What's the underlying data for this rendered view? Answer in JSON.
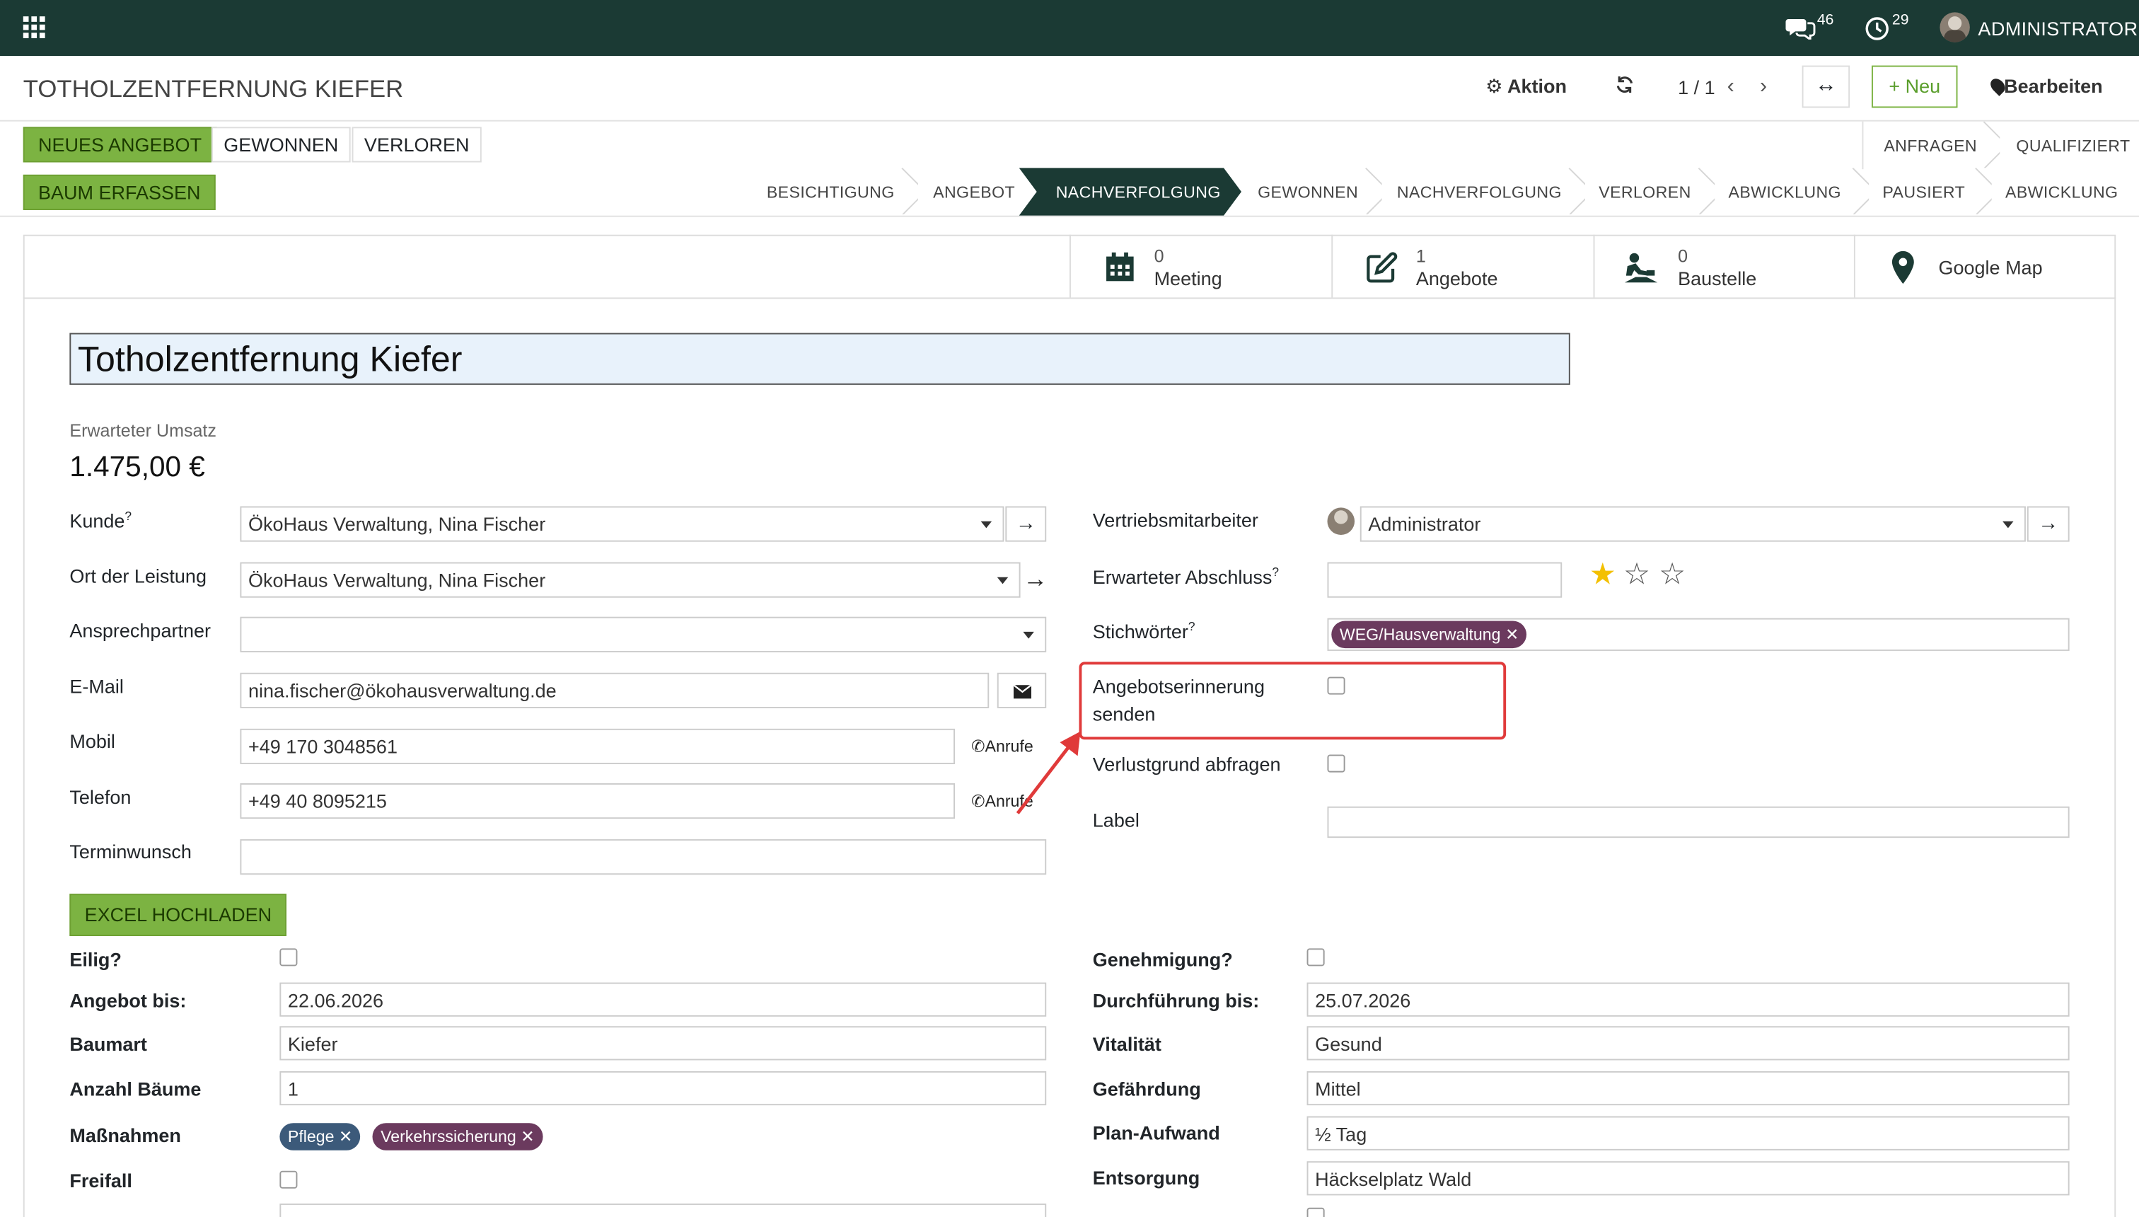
{
  "topbar": {
    "chat_count": "46",
    "activity_count": "29",
    "user": "ADMINISTRATOR"
  },
  "record": {
    "title": "TOTHOLZENTFERNUNG KIEFER",
    "action": "Aktion",
    "pager": "1 / 1",
    "new": "Neu",
    "edit": "Bearbeiten"
  },
  "buttons": {
    "new_offer": "NEUES ANGEBOT",
    "won": "GEWONNEN",
    "lost": "VERLOREN",
    "capture_tree": "BAUM ERFASSEN"
  },
  "stages_row1": [
    "ANFRAGEN",
    "QUALIFIZIERT"
  ],
  "stages": [
    "BESICHTIGUNG",
    "ANGEBOT",
    "NACHVERFOLGUNG",
    "GEWONNEN",
    "NACHVERFOLGUNG",
    "VERLOREN",
    "ABWICKLUNG",
    "PAUSIERT",
    "ABWICKLUNG"
  ],
  "smart": [
    {
      "count": "0",
      "label": "Meeting"
    },
    {
      "count": "1",
      "label": "Angebote"
    },
    {
      "count": "0",
      "label": "Baustelle"
    },
    {
      "count": "",
      "label": "Google Map"
    }
  ],
  "name": "Totholzentfernung Kiefer",
  "revenue": {
    "label": "Erwarteter Umsatz",
    "value": "1.475,00 €"
  },
  "left": {
    "kunde": {
      "label": "Kunde",
      "value": "ÖkoHaus Verwaltung, Nina Fischer"
    },
    "ort": {
      "label": "Ort der Leistung",
      "value": "ÖkoHaus Verwaltung, Nina Fischer"
    },
    "ansprech": {
      "label": "Ansprechpartner",
      "value": ""
    },
    "email": {
      "label": "E-Mail",
      "value": "nina.fischer@ökohausverwaltung.de"
    },
    "mobil": {
      "label": "Mobil",
      "value": "+49 170 3048561",
      "call": "Anrufe"
    },
    "telefon": {
      "label": "Telefon",
      "value": "+49 40 8095215",
      "call": "Anrufe"
    },
    "termin": {
      "label": "Terminwunsch",
      "value": ""
    }
  },
  "right": {
    "vertrieb": {
      "label": "Vertriebsmitarbeiter",
      "value": "Administrator"
    },
    "abschluss": {
      "label": "Erwarteter Abschluss",
      "value": "",
      "stars": 1
    },
    "stichwort": {
      "label": "Stichwörter",
      "tag": "WEG/Hausverwaltung"
    },
    "erinnerung": {
      "label1": "Angebotserinnerung",
      "label2": "senden"
    },
    "verlust": {
      "label": "Verlustgrund abfragen"
    },
    "labelf": {
      "label": "Label",
      "value": ""
    }
  },
  "excel": "EXCEL HOCHLADEN",
  "bottom_left": {
    "eilig": "Eilig?",
    "angebot_bis": {
      "label": "Angebot bis:",
      "value": "22.06.2026"
    },
    "baumart": {
      "label": "Baumart",
      "value": "Kiefer"
    },
    "anzahl": {
      "label": "Anzahl Bäume",
      "value": "1"
    },
    "massnahmen": {
      "label": "Maßnahmen",
      "tags": [
        "Pflege",
        "Verkehrssicherung"
      ]
    },
    "freifall": "Freifall"
  },
  "bottom_right": {
    "genehmigung": "Genehmigung?",
    "durchfuehrung": {
      "label": "Durchführung bis:",
      "value": "25.07.2026"
    },
    "vitalitaet": {
      "label": "Vitalität",
      "value": "Gesund"
    },
    "gefaehrdung": {
      "label": "Gefährdung",
      "value": "Mittel"
    },
    "plan": {
      "label": "Plan-Aufwand",
      "value": "½ Tag"
    },
    "entsorgung": {
      "label": "Entsorgung",
      "value": "Häckselplatz Wald"
    }
  },
  "colors": {
    "brand": "#1b3a34",
    "accent_green": "#7cb342",
    "tag_purple": "#6b3a5e",
    "tag_blue": "#3c5a7a",
    "highlight": "#e03a3a"
  }
}
